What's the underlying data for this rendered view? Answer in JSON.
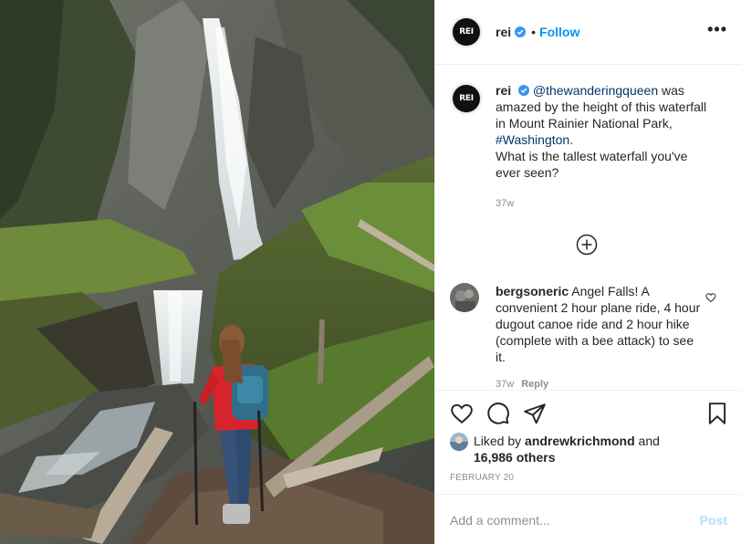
{
  "header": {
    "username": "rei",
    "dot": "•",
    "follow_label": "Follow",
    "more_label": "•••",
    "logo_text": "REI"
  },
  "caption": {
    "username": "rei",
    "mention": "@thewanderingqueen",
    "text_1": "was amazed by the height of this waterfall in Mount Rainier National Park,",
    "hashtag": "#Washington",
    "text_2": ".",
    "text_3": "What is the tallest waterfall you've ever seen?",
    "time": "37w"
  },
  "comment": {
    "username": "bergsoneric",
    "text": "Angel Falls! A convenient 2 hour plane ride, 4 hour dugout canoe ride and 2 hour hike (complete with a bee attack) to see it.",
    "time": "37w",
    "reply": "Reply"
  },
  "likes": {
    "prefix": "Liked by",
    "user": "andrewkrichmond",
    "and": "and",
    "count": "16,986 others"
  },
  "date": "FEBRUARY 20",
  "add_comment": {
    "placeholder": "Add a comment...",
    "post_label": "Post"
  },
  "icons": {
    "verified": "verified-badge-icon",
    "more": "more-options-icon",
    "load_more": "plus-circle-icon",
    "like": "heart-icon",
    "comment": "comment-icon",
    "share": "share-icon",
    "save": "bookmark-icon"
  },
  "colors": {
    "follow": "#0095f6",
    "link": "#00376b",
    "muted": "#8e8e8e",
    "post_disabled": "#b2dffc"
  }
}
